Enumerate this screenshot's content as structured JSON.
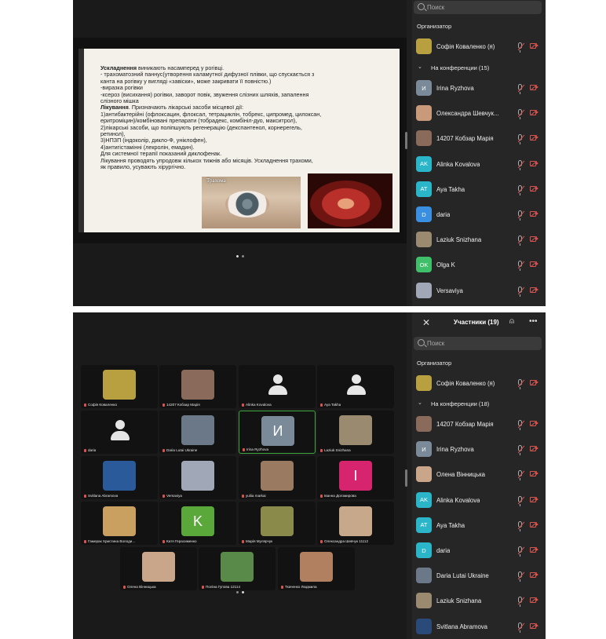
{
  "screen1": {
    "slide": {
      "text": {
        "complications_heading": "Ускладнення",
        "complications_intro": " виникають насамперед у рогівці.",
        "line_pannus": "- трахоматозний паннус(утворення каламутної дифузної плівки, що спускається з",
        "line_pannus2": "канта на рогівку у вигляді «завіски», може закривати її повністю.)",
        "line_ulcer": "-виразка рогівки",
        "line_xerosis": "-ксероз (висихання) рогівки, заворот повік, звуження слізних шляхів, запалення",
        "line_xerosis2": "слізного мішка",
        "treatment_heading": "Лікування",
        "treatment_intro": ". Призначають лікарські засоби місцевої дії:",
        "item1": "1)антибактерійні (офлоксацин, флоксал, тетрациклін, тобрекс, ципромед, цилоксан,",
        "item1b": "еритроміцин)/комбіновані препарати (тобрадекс, комбініл-дуо, макситрол),",
        "item2": "2)лікарські засоби, що поліпшують регенерацію (декспантенол, корнерегель,",
        "item2b": "ретинол),",
        "item3": "3)НПЗП (індоколір, дикло-Ф, уніклофен),",
        "item4": "4)антигістамінні (лекролін, емадин).",
        "systemic": " Для системної терапії показаний диклофенак.",
        "duration": "Лікування проводять упродовж кількох тижнів або місяців. Ускладнення трахоми,",
        "duration2": "як правило, усувають хірургічно."
      },
      "image_caption": "Трахома"
    },
    "panel": {
      "search_placeholder": "Поиск",
      "organizer_label": "Организатор",
      "organizer": {
        "name": "Софія Коваленко (я)"
      },
      "conference_label": "На конференции (15)",
      "participants": [
        {
          "name": "Irina Ryzhova",
          "initials": "И",
          "color": "#7a8a99"
        },
        {
          "name": "Олександра Шевчук...",
          "initials": "",
          "color": "#c89a7a"
        },
        {
          "name": "14207 Кобзар Марія",
          "initials": "",
          "color": "#8a6a5a"
        },
        {
          "name": "Alinka Kovalova",
          "initials": "AK",
          "color": "#2bb5c8"
        },
        {
          "name": "Aya Takha",
          "initials": "AT",
          "color": "#2bb5c8"
        },
        {
          "name": "daria",
          "initials": "D",
          "color": "#3a8fe0"
        },
        {
          "name": "Laziuk Snizhana",
          "initials": "",
          "color": "#9a8a70"
        },
        {
          "name": "Olga K",
          "initials": "OK",
          "color": "#3fbf6a"
        },
        {
          "name": "Versaviya",
          "initials": "",
          "color": "#a0a8b8"
        }
      ]
    }
  },
  "screen2": {
    "panel": {
      "title": "Участники (19)",
      "search_placeholder": "Поиск",
      "organizer_label": "Организатор",
      "organizer": {
        "name": "Софія Коваленко (я)"
      },
      "conference_label": "На конференции (18)",
      "participants": [
        {
          "name": "14207 Кобзар Марія",
          "initials": "",
          "color": "#8a6a5a"
        },
        {
          "name": "Irina Ryzhova",
          "initials": "И",
          "color": "#7a8a99"
        },
        {
          "name": "Олена Вінницька",
          "initials": "",
          "color": "#c9a58a"
        },
        {
          "name": "Alinka Kovalova",
          "initials": "AK",
          "color": "#2bb5c8"
        },
        {
          "name": "Aya Takha",
          "initials": "AT",
          "color": "#2bb5c8"
        },
        {
          "name": "daria",
          "initials": "D",
          "color": "#2bb5c8"
        },
        {
          "name": "Daria Lutai Ukraine",
          "initials": "",
          "color": "#6a7888"
        },
        {
          "name": "Laziuk Snizhana",
          "initials": "",
          "color": "#9a8a70"
        },
        {
          "name": "Svitlana Abramova",
          "initials": "",
          "color": "#2a4a7a"
        }
      ]
    },
    "tiles": [
      {
        "name": "Софія Коваленко",
        "kind": "photo",
        "color": "#b8a040"
      },
      {
        "name": "14207 Кобзар Марія",
        "kind": "photo",
        "color": "#8a6a5a"
      },
      {
        "name": "Alinka Kovalova",
        "kind": "person"
      },
      {
        "name": "Aya Takha",
        "kind": "person"
      },
      {
        "name": "daria",
        "kind": "person"
      },
      {
        "name": "Daria Lutai Ukraine",
        "kind": "photo",
        "color": "#6a7888"
      },
      {
        "name": "Irina Ryzhova",
        "kind": "letter",
        "letter": "И",
        "color": "#7a8a99",
        "active": true
      },
      {
        "name": "Laziuk Snizhana",
        "kind": "photo",
        "color": "#9a8a70"
      },
      {
        "name": "Svitlana Abramova",
        "kind": "photo",
        "color": "#2a5a9a"
      },
      {
        "name": "Versaviya",
        "kind": "photo",
        "color": "#a0a8b8"
      },
      {
        "name": "yuliia markai",
        "kind": "photo",
        "color": "#9a7a60"
      },
      {
        "name": "Іванна Догомирова",
        "kind": "letter",
        "letter": "І",
        "color": "#d6246e"
      },
      {
        "name": "Гамерак Христина Володи...",
        "kind": "photo",
        "color": "#c9a060"
      },
      {
        "name": "Катя Герасименко",
        "kind": "letter",
        "letter": "K",
        "color": "#5aa83a"
      },
      {
        "name": "Марія Мулярчук",
        "kind": "photo",
        "color": "#8a8a4a"
      },
      {
        "name": "Олександра Шевчук 11112",
        "kind": "photo",
        "color": "#c8a88a"
      },
      {
        "name": "Олена Вінницька",
        "kind": "photo",
        "color": "#c9a58a"
      },
      {
        "name": "Поліна Гупова 12114",
        "kind": "photo",
        "color": "#5a8a4a"
      },
      {
        "name": "Ткаченко Людмила",
        "kind": "photo",
        "color": "#b08060"
      }
    ]
  }
}
